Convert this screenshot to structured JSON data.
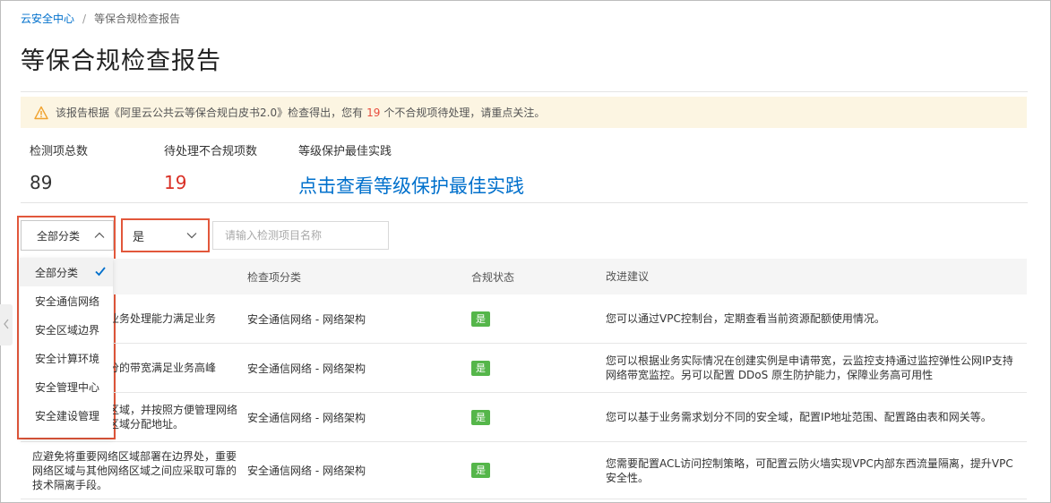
{
  "breadcrumb": {
    "root": "云安全中心",
    "separator": "/",
    "current": "等保合规检查报告"
  },
  "page_title": "等保合规检查报告",
  "alert": {
    "icon": "warning-icon",
    "text_before": "该报告根据《阿里云公共云等保合规白皮书2.0》检查得出，您有",
    "count": "19",
    "text_after": "个不合规项待处理，请重点关注。",
    "background": "#fcf5e2"
  },
  "stats": {
    "total_label": "检测项总数",
    "total_value": "89",
    "pending_label": "待处理不合规项数",
    "pending_value": "19",
    "best_label": "等级保护最佳实践",
    "best_link": "点击查看等级保护最佳实践"
  },
  "filters": {
    "category_selected": "全部分类",
    "compliance_selected": "是",
    "search_placeholder": "请输入检测项目名称"
  },
  "category_dropdown": {
    "options": [
      "全部分类",
      "安全通信网络",
      "安全区域边界",
      "安全计算环境",
      "安全管理中心",
      "安全建设管理"
    ],
    "selected_index": 0
  },
  "table": {
    "headers": {
      "category": "检查项分类",
      "status": "合规状态",
      "advice": "改进建议"
    },
    "rows": [
      {
        "requirement": "业务处理能力满足业务",
        "category": "安全通信网络 - 网络架构",
        "status": "是",
        "advice": "您可以通过VPC控制台，定期查看当前资源配额使用情况。"
      },
      {
        "requirement": "分的带宽满足业务高峰",
        "category": "安全通信网络 - 网络架构",
        "status": "是",
        "advice": "您可以根据业务实际情况在创建实例是申请带宽，云监控支持通过监控弹性公网IP支持网络带宽监控。另可以配置 DDoS 原生防护能力，保障业务高可用性"
      },
      {
        "requirement": "区域，并按照方便管理网络区域分配地址。",
        "category": "安全通信网络 - 网络架构",
        "status": "是",
        "advice": "您可以基于业务需求划分不同的安全域，配置IP地址范围、配置路由表和网关等。"
      },
      {
        "requirement": "应避免将重要网络区域部署在边界处，重要网络区域与其他网络区域之间应采取可靠的技术隔离手段。",
        "category": "安全通信网络 - 网络架构",
        "status": "是",
        "advice": "您需要配置ACL访问控制策略，可配置云防火墙实现VPC内部东西流量隔离，提升VPC安全性。"
      }
    ]
  },
  "colors": {
    "link": "#0070cc",
    "danger": "#d93026",
    "success": "#55b64a",
    "highlight": "#e2573b"
  }
}
